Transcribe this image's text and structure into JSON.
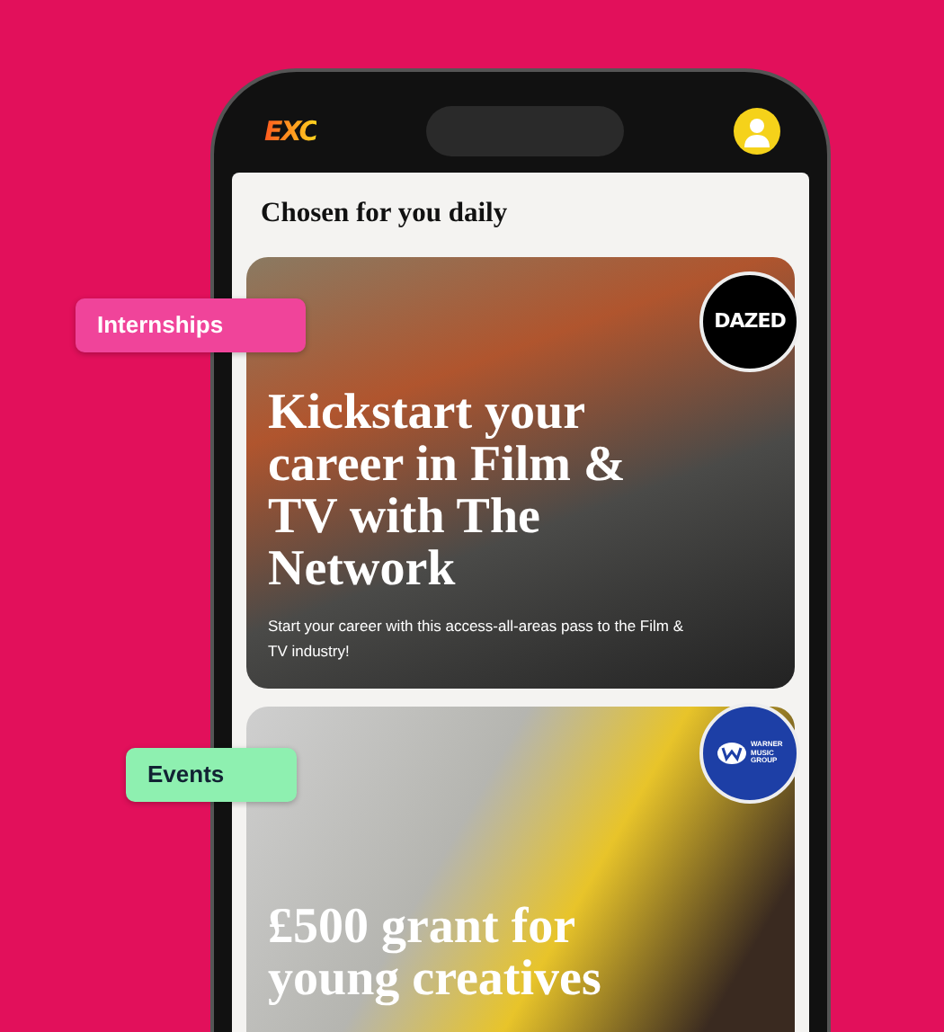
{
  "app": {
    "logo": "EXC"
  },
  "section": {
    "title": "Chosen for you daily"
  },
  "cards": [
    {
      "category": "Internships",
      "color": "#f0449a",
      "partner": {
        "kind": "wordmark",
        "text": "DAZED"
      },
      "title": "Kickstart your career in Film & TV with The Network",
      "description": "Start your career with this access-all-areas pass to the Film & TV industry!"
    },
    {
      "category": "Events",
      "color": "#8ef0b0",
      "partner": {
        "kind": "emblem",
        "text": "WARNER MUSIC GROUP"
      },
      "title": "£500 grant for young creatives"
    }
  ]
}
